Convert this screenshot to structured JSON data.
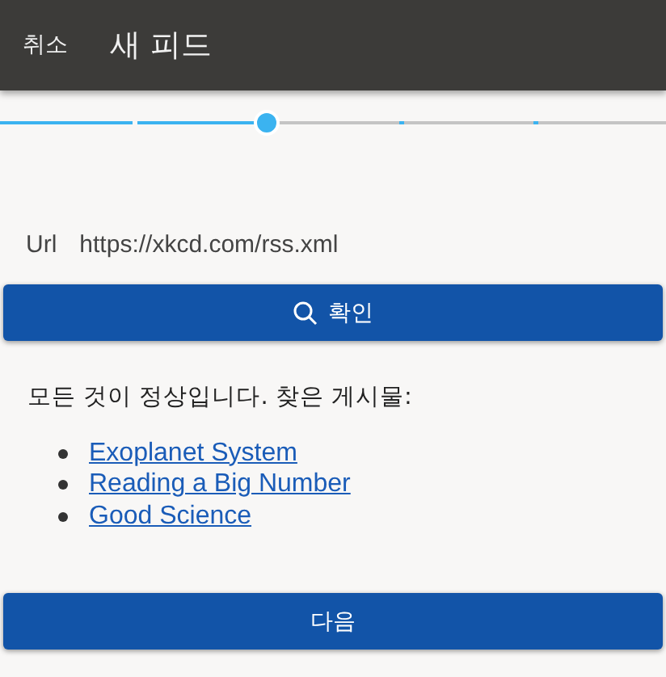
{
  "app_bar": {
    "cancel": "취소",
    "title": "새 피드"
  },
  "stepper": {
    "level": 0.4
  },
  "url_field": {
    "label": "Url",
    "value": "https://xkcd.com/rss.xml"
  },
  "check_button": {
    "label": "확인"
  },
  "status_text": "모든 것이 정상입니다. 찾은 게시물:",
  "posts": [
    {
      "title": "Exoplanet System"
    },
    {
      "title": "Reading a Big Number"
    },
    {
      "title": "Good Science"
    }
  ],
  "next_button": {
    "label": "다음"
  }
}
